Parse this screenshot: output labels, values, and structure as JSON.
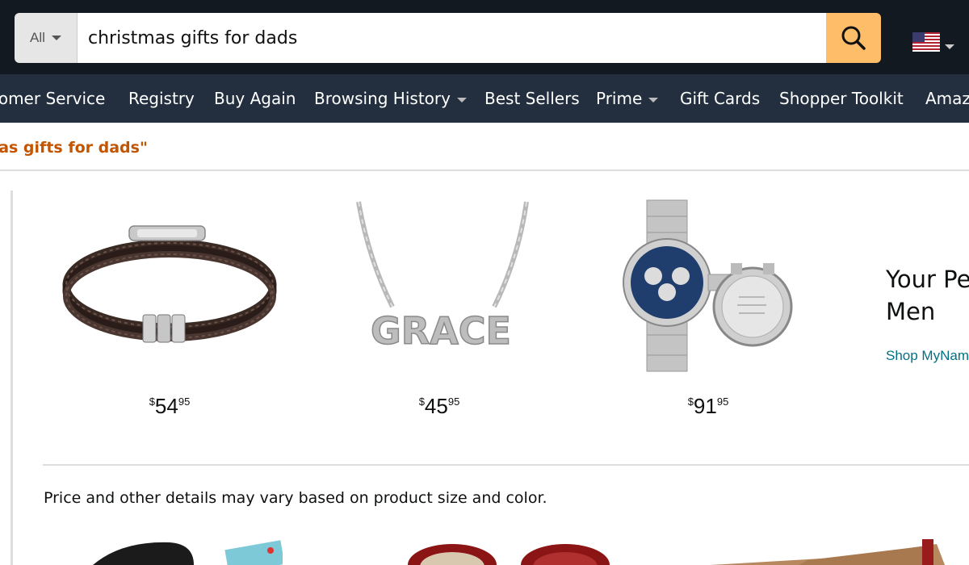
{
  "search": {
    "department": "All",
    "query": "christmas gifts for dads"
  },
  "nav": {
    "items": [
      {
        "label": "tomer Service"
      },
      {
        "label": "Registry"
      },
      {
        "label": "Buy Again"
      },
      {
        "label": "Browsing History"
      },
      {
        "label": "Best Sellers"
      },
      {
        "label": "Prime"
      },
      {
        "label": "Gift Cards"
      },
      {
        "label": "Shopper Toolkit"
      },
      {
        "label": "Amaz"
      }
    ]
  },
  "results": {
    "label": "stmas gifts for dads\""
  },
  "products": [
    {
      "price_symbol": "$",
      "price_whole": "54",
      "price_fraction": "95"
    },
    {
      "price_symbol": "$",
      "price_whole": "45",
      "price_fraction": "95",
      "name_engraving": "GRACE"
    },
    {
      "price_symbol": "$",
      "price_whole": "91",
      "price_fraction": "95"
    }
  ],
  "promo": {
    "title_line1": "Your Pe",
    "title_line2": "Men",
    "link": "Shop MyNam"
  },
  "note": "Price and other details may vary based on product size and color.",
  "colors": {
    "topbar": "#131921",
    "nav": "#232f3e",
    "search_button": "#febd69",
    "results_accent": "#c45500",
    "link": "#007185"
  }
}
